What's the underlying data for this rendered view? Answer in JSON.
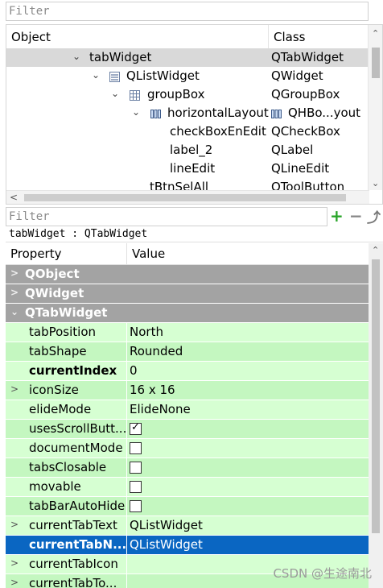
{
  "object_filter": {
    "placeholder": "Filter"
  },
  "object_inspector": {
    "col_object": "Object",
    "col_class": "Class",
    "rows": [
      {
        "name": "tabWidget",
        "cls": "QTabWidget"
      },
      {
        "name": "QListWidget",
        "cls": "QWidget"
      },
      {
        "name": "groupBox",
        "cls": "QGroupBox"
      },
      {
        "name": "horizontalLayout",
        "cls": "QHBo...yout"
      },
      {
        "name": "checkBoxEnEdit",
        "cls": "QCheckBox"
      },
      {
        "name": "label_2",
        "cls": "QLabel"
      },
      {
        "name": "lineEdit",
        "cls": "QLineEdit"
      },
      {
        "name": "tBtnSelAll",
        "cls": "QToolButton"
      }
    ]
  },
  "property_filter": {
    "placeholder": "Filter"
  },
  "class_line": "tabWidget : QTabWidget",
  "property_editor": {
    "col_property": "Property",
    "col_value": "Value",
    "groups": [
      "QObject",
      "QWidget",
      "QTabWidget"
    ],
    "props": [
      {
        "name": "tabPosition",
        "value": "North"
      },
      {
        "name": "tabShape",
        "value": "Rounded"
      },
      {
        "name": "currentIndex",
        "value": "0"
      },
      {
        "name": "iconSize",
        "value": "16 x 16"
      },
      {
        "name": "elideMode",
        "value": "ElideNone"
      },
      {
        "name": "usesScrollButt...",
        "checked": true
      },
      {
        "name": "documentMode",
        "checked": false
      },
      {
        "name": "tabsClosable",
        "checked": false
      },
      {
        "name": "movable",
        "checked": false
      },
      {
        "name": "tabBarAutoHide",
        "checked": false
      },
      {
        "name": "currentTabText",
        "value": "QListWidget"
      },
      {
        "name": "currentTabN...",
        "value": "QListWidget"
      },
      {
        "name": "currentTabIcon",
        "value": ""
      },
      {
        "name": "currentTabTo...",
        "value": ""
      }
    ]
  },
  "watermark": "CSDN @生途南北"
}
